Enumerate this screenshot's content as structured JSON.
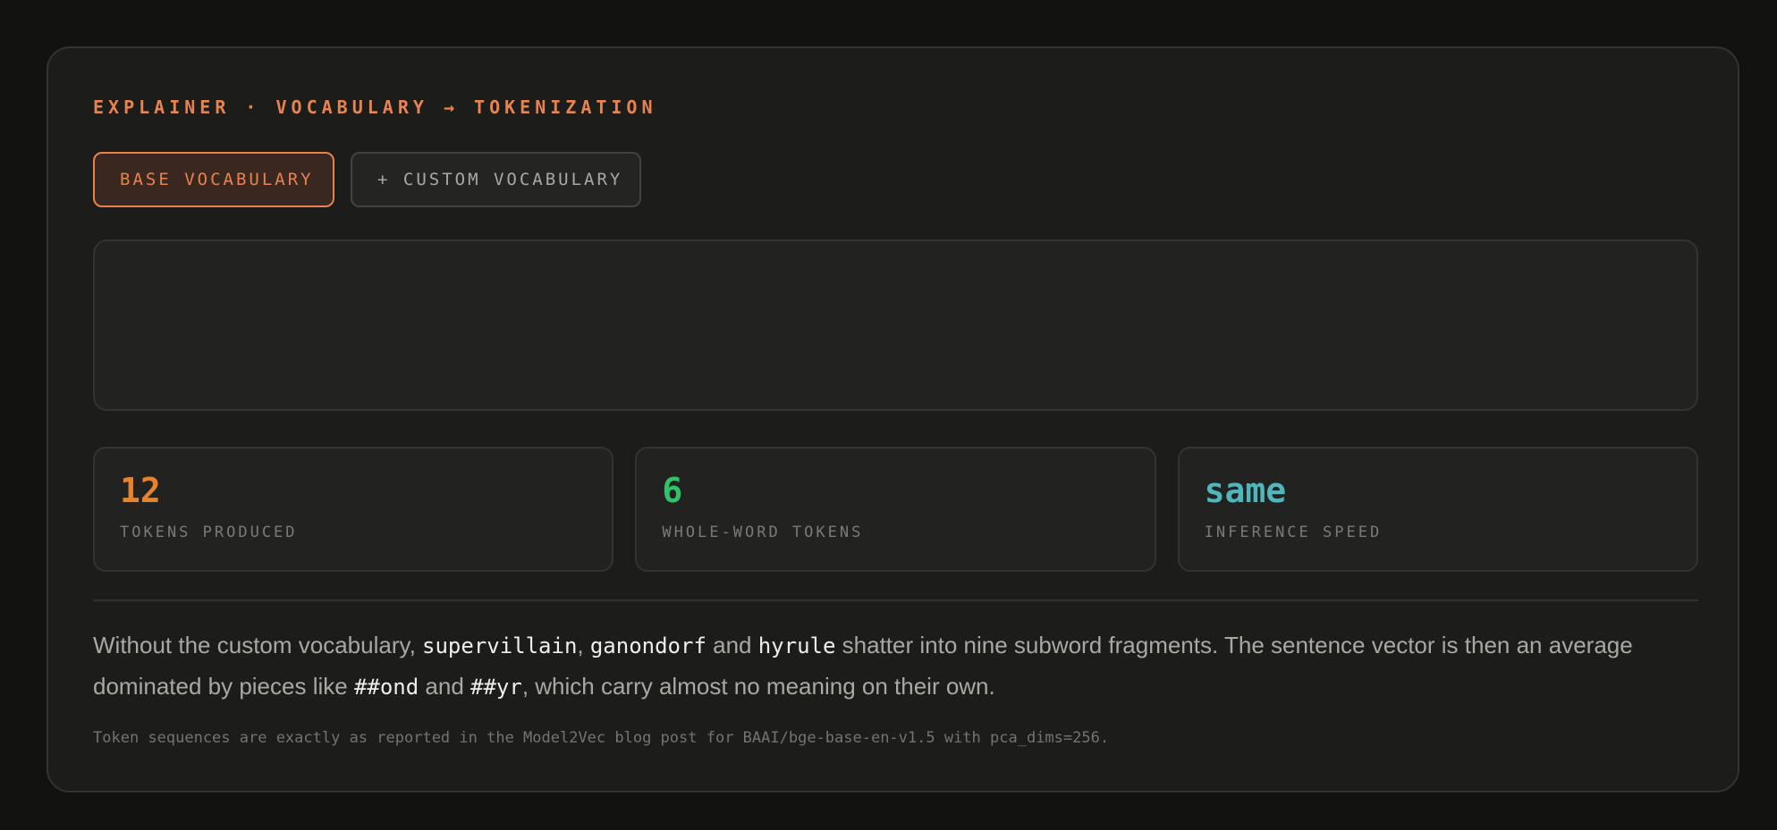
{
  "eyebrow": "EXPLAINER · VOCABULARY → TOKENIZATION",
  "tabs": [
    {
      "label": "BASE VOCABULARY",
      "active": true
    },
    {
      "label": "+ CUSTOM VOCABULARY",
      "active": false
    }
  ],
  "stats": [
    {
      "value": "12",
      "label": "TOKENS PRODUCED",
      "color": "#e8832a"
    },
    {
      "value": "6",
      "label": "WHOLE-WORD TOKENS",
      "color": "#33c06a"
    },
    {
      "value": "same",
      "label": "INFERENCE SPEED",
      "color": "#4fb6bd"
    }
  ],
  "explanation": {
    "t1": "Without the custom vocabulary, ",
    "c1": "supervillain",
    "t2": ", ",
    "c2": "ganondorf",
    "t3": " and ",
    "c3": "hyrule",
    "t4": " shatter into nine subword fragments. The sentence vector is then an average dominated by pieces like ",
    "c4": "##ond",
    "t5": " and ",
    "c5": "##yr",
    "t6": ", which carry almost no meaning on their own."
  },
  "footnote": "Token sequences are exactly as reported in the Model2Vec blog post for BAAI/bge-base-en-v1.5 with pca_dims=256."
}
